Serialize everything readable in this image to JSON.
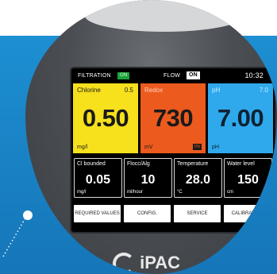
{
  "status_bar": {
    "filtration_label": "FILTRATION",
    "filtration_badge": "ON",
    "flow_label": "FLOW",
    "flow_badge": "ON",
    "time": "10:32"
  },
  "tiles": [
    {
      "label": "Chlorine",
      "aux": "0.5",
      "value": "0.50",
      "unit": "mg/l",
      "color": "#f7e01c"
    },
    {
      "label": "Redox",
      "aux": "",
      "value": "730",
      "unit": "mV",
      "tag": "ON",
      "color": "#ec5a1e"
    },
    {
      "label": "pH",
      "aux": "7.0",
      "value": "7.00",
      "unit": "pH",
      "color": "#2fa9ec"
    }
  ],
  "sub_tiles": [
    {
      "label": "Cl bounded",
      "value": "0.05",
      "unit": "mg/l"
    },
    {
      "label": "Flocc/Alg",
      "value": "10",
      "unit": "ml/hour"
    },
    {
      "label": "Temperature",
      "value": "28.0",
      "unit": "°C"
    },
    {
      "label": "Water level",
      "value": "150",
      "unit": "cm"
    }
  ],
  "buttons": {
    "required_values": "REQUIRED VALUES",
    "config": "CONFIG.",
    "service": "SERVICE",
    "calibration": "CALIBRATION"
  },
  "brand": {
    "logo_text": "iPAC",
    "accent_blue": "#1d8fd2"
  }
}
